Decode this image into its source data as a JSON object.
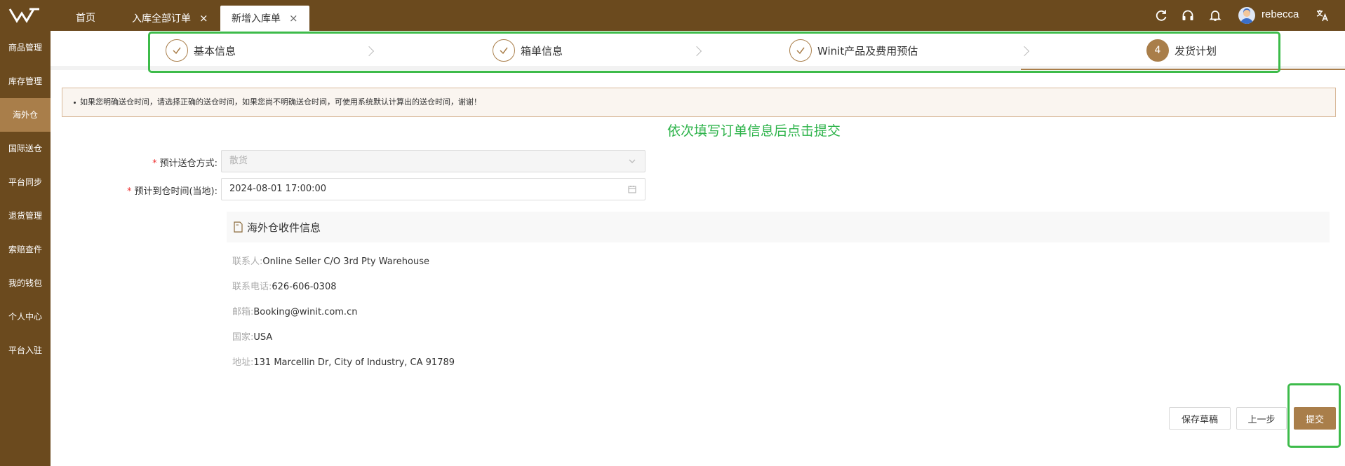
{
  "topbar": {
    "tabs": [
      {
        "label": "首页"
      },
      {
        "label": "入库全部订单",
        "close": "×"
      },
      {
        "label": "新增入库单",
        "close": "×"
      }
    ],
    "username": "rebecca",
    "icons": [
      "refresh-icon",
      "headset-icon",
      "bell-icon",
      "translate-icon"
    ]
  },
  "sidebar": {
    "items": [
      {
        "label": "商品管理"
      },
      {
        "label": "库存管理"
      },
      {
        "label": "海外仓",
        "active": true
      },
      {
        "label": "国际送仓"
      },
      {
        "label": "平台同步"
      },
      {
        "label": "退货管理"
      },
      {
        "label": "索赔查件"
      },
      {
        "label": "我的钱包"
      },
      {
        "label": "个人中心"
      },
      {
        "label": "平台入驻"
      }
    ]
  },
  "steps": [
    {
      "label": "基本信息",
      "state": "done"
    },
    {
      "label": "箱单信息",
      "state": "done"
    },
    {
      "label": "Winit产品及费用预估",
      "state": "done"
    },
    {
      "label": "发货计划",
      "state": "current",
      "number": "4"
    }
  ],
  "notice": "如果您明确送仓时间，请选择正确的送仓时间，如果您尚不明确送仓时间，可使用系统默认计算出的送仓时间，谢谢！",
  "annotation": "依次填写订单信息后点击提交",
  "form": {
    "delivery_method": {
      "label": "预计送仓方式:",
      "value": "散货",
      "required": "*"
    },
    "arrival_time": {
      "label": "预计到仓时间(当地):",
      "value": "2024-08-01 17:00:00",
      "required": "*"
    }
  },
  "warehouse": {
    "title": "海外仓收件信息",
    "contact": {
      "key": "联系人:",
      "value": "Online Seller C/O 3rd Pty Warehouse"
    },
    "phone": {
      "key": "联系电话:",
      "value": "626-606-0308"
    },
    "email": {
      "key": "邮箱:",
      "value": "Booking@winit.com.cn"
    },
    "country": {
      "key": "国家:",
      "value": "USA"
    },
    "address": {
      "key": "地址:",
      "value": "131 Marcellin Dr, City of Industry, CA 91789"
    }
  },
  "buttons": {
    "save_draft": "保存草稿",
    "prev": "上一步",
    "submit": "提交"
  },
  "colors": {
    "brand": "#6b4a1e",
    "accent": "#a97e4a",
    "highlight": "#3dbb4a"
  }
}
